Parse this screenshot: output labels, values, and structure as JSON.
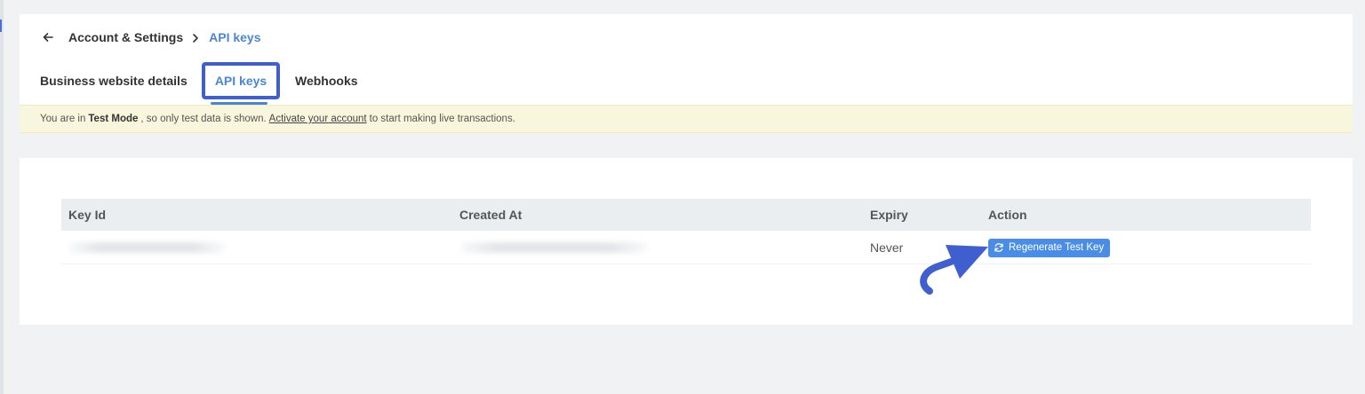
{
  "breadcrumb": {
    "parent": "Account & Settings",
    "current": "API keys"
  },
  "tabs": [
    {
      "label": "Business website details",
      "active": false
    },
    {
      "label": "API keys",
      "active": true
    },
    {
      "label": "Webhooks",
      "active": false
    }
  ],
  "banner": {
    "prefix": "You are in",
    "mode": "Test Mode",
    "middle": ", so only test data is shown.",
    "link": "Activate your account",
    "suffix": "to start making live transactions."
  },
  "table": {
    "headers": {
      "key_id": "Key Id",
      "created_at": "Created At",
      "expiry": "Expiry",
      "action": "Action"
    },
    "rows": [
      {
        "expiry": "Never",
        "action_label": "Regenerate Test Key"
      }
    ]
  },
  "colors": {
    "accent": "#4a86d8",
    "highlight_border": "#3f5fd0",
    "button": "#4a8de6",
    "banner_bg": "#f8f7de",
    "callout_arrow": "#3f5fd0"
  },
  "icons": {
    "back": "arrow-left-icon",
    "separator": "chevron-right-icon",
    "regenerate": "refresh-icon",
    "callout": "curved-arrow-icon"
  }
}
